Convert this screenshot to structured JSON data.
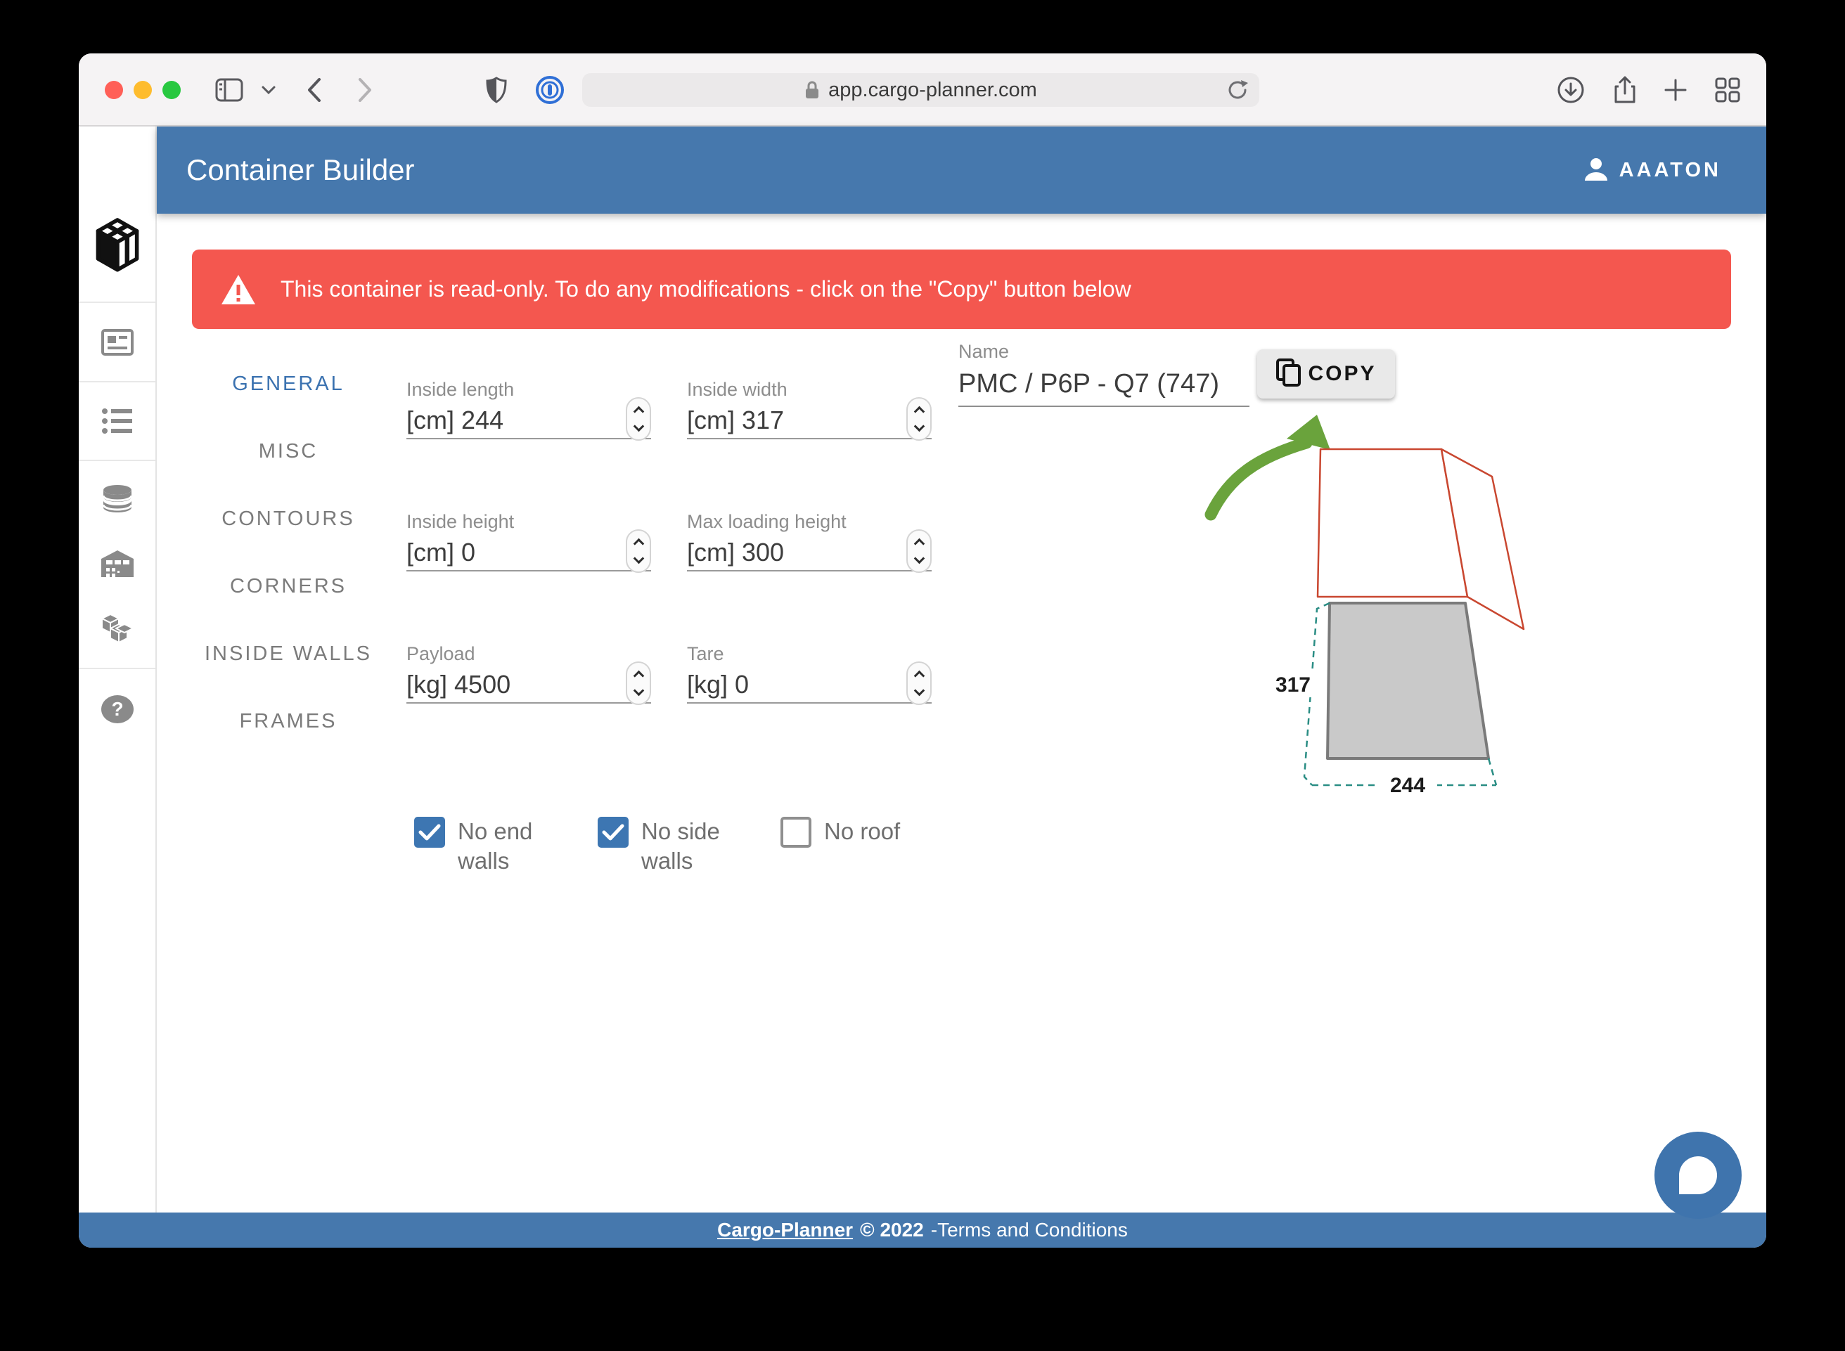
{
  "browser": {
    "url": "app.cargo-planner.com"
  },
  "app": {
    "title": "Container Builder",
    "user": "AAATON"
  },
  "banner": {
    "text": "This container is read-only. To do any modifications - click on the \"Copy\" button below"
  },
  "nav": {
    "items": [
      {
        "label": "GENERAL",
        "active": true
      },
      {
        "label": "MISC",
        "active": false
      },
      {
        "label": "CONTOURS",
        "active": false
      },
      {
        "label": "CORNERS",
        "active": false
      },
      {
        "label": "INSIDE WALLS",
        "active": false
      },
      {
        "label": "FRAMES",
        "active": false
      }
    ]
  },
  "form": {
    "fields": [
      {
        "label": "Inside length",
        "value": "[cm] 244"
      },
      {
        "label": "Inside width",
        "value": "[cm] 317"
      },
      {
        "label": "Inside height",
        "value": "[cm] 0"
      },
      {
        "label": "Max loading height",
        "value": "[cm] 300"
      },
      {
        "label": "Payload",
        "value": "[kg] 4500"
      },
      {
        "label": "Tare",
        "value": "[kg] 0"
      }
    ],
    "name_field": {
      "label": "Name",
      "value": "PMC / P6P - Q7 (747)"
    },
    "copy_button_label": "COPY",
    "checkboxes": [
      {
        "label": "No end walls",
        "checked": true
      },
      {
        "label": "No side walls",
        "checked": true
      },
      {
        "label": "No roof",
        "checked": false
      }
    ]
  },
  "diagram": {
    "width_label": "317",
    "length_label": "244"
  },
  "footer": {
    "brand": "Cargo-Planner",
    "copyright": "© 2022",
    "terms": "-Terms and Conditions"
  },
  "colors": {
    "header_blue": "#4678ad",
    "banner_red": "#f4574f",
    "accent_blue": "#3b72b0",
    "checkbox_blue": "#3d76b2",
    "arrow_green": "#6aa33c",
    "wireframe_red": "#c94730",
    "dimension_teal": "#2a8d84"
  }
}
